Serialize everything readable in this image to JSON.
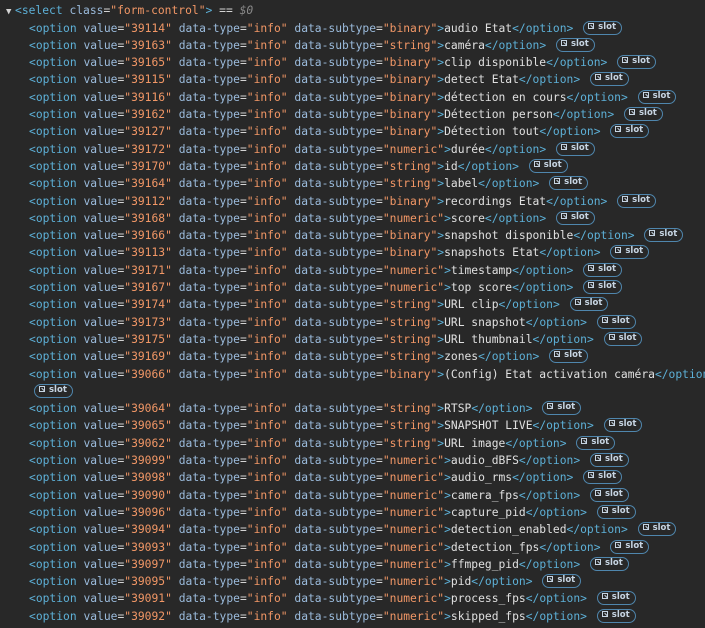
{
  "select": {
    "tag": "select",
    "attr_name": "class",
    "attr_value": "form-control",
    "eq_text": "==",
    "ref": "$0"
  },
  "option_tag": "option",
  "slot_label": "slot",
  "options": [
    {
      "value": "39114",
      "type": "info",
      "subtype": "binary",
      "text": "audio Etat"
    },
    {
      "value": "39163",
      "type": "info",
      "subtype": "string",
      "text": "caméra"
    },
    {
      "value": "39165",
      "type": "info",
      "subtype": "binary",
      "text": "clip disponible"
    },
    {
      "value": "39115",
      "type": "info",
      "subtype": "binary",
      "text": "detect Etat"
    },
    {
      "value": "39116",
      "type": "info",
      "subtype": "binary",
      "text": "détection en cours"
    },
    {
      "value": "39162",
      "type": "info",
      "subtype": "binary",
      "text": "Détection person"
    },
    {
      "value": "39127",
      "type": "info",
      "subtype": "binary",
      "text": "Détection tout"
    },
    {
      "value": "39172",
      "type": "info",
      "subtype": "numeric",
      "text": "durée"
    },
    {
      "value": "39170",
      "type": "info",
      "subtype": "string",
      "text": "id"
    },
    {
      "value": "39164",
      "type": "info",
      "subtype": "string",
      "text": "label"
    },
    {
      "value": "39112",
      "type": "info",
      "subtype": "binary",
      "text": "recordings Etat"
    },
    {
      "value": "39168",
      "type": "info",
      "subtype": "numeric",
      "text": "score"
    },
    {
      "value": "39166",
      "type": "info",
      "subtype": "binary",
      "text": "snapshot disponible"
    },
    {
      "value": "39113",
      "type": "info",
      "subtype": "binary",
      "text": "snapshots Etat"
    },
    {
      "value": "39171",
      "type": "info",
      "subtype": "numeric",
      "text": "timestamp"
    },
    {
      "value": "39167",
      "type": "info",
      "subtype": "numeric",
      "text": "top score"
    },
    {
      "value": "39174",
      "type": "info",
      "subtype": "string",
      "text": "URL clip"
    },
    {
      "value": "39173",
      "type": "info",
      "subtype": "string",
      "text": "URL snapshot"
    },
    {
      "value": "39175",
      "type": "info",
      "subtype": "string",
      "text": "URL thumbnail"
    },
    {
      "value": "39169",
      "type": "info",
      "subtype": "string",
      "text": "zones"
    },
    {
      "value": "39066",
      "type": "info",
      "subtype": "binary",
      "text": "(Config) Etat activation caméra",
      "wrap": true
    },
    {
      "value": "39064",
      "type": "info",
      "subtype": "string",
      "text": "RTSP"
    },
    {
      "value": "39065",
      "type": "info",
      "subtype": "string",
      "text": "SNAPSHOT LIVE"
    },
    {
      "value": "39062",
      "type": "info",
      "subtype": "string",
      "text": "URL image"
    },
    {
      "value": "39099",
      "type": "info",
      "subtype": "numeric",
      "text": "audio_dBFS"
    },
    {
      "value": "39098",
      "type": "info",
      "subtype": "numeric",
      "text": "audio_rms"
    },
    {
      "value": "39090",
      "type": "info",
      "subtype": "numeric",
      "text": "camera_fps"
    },
    {
      "value": "39096",
      "type": "info",
      "subtype": "numeric",
      "text": "capture_pid"
    },
    {
      "value": "39094",
      "type": "info",
      "subtype": "numeric",
      "text": "detection_enabled"
    },
    {
      "value": "39093",
      "type": "info",
      "subtype": "numeric",
      "text": "detection_fps"
    },
    {
      "value": "39097",
      "type": "info",
      "subtype": "numeric",
      "text": "ffmpeg_pid"
    },
    {
      "value": "39095",
      "type": "info",
      "subtype": "numeric",
      "text": "pid"
    },
    {
      "value": "39091",
      "type": "info",
      "subtype": "numeric",
      "text": "process_fps"
    },
    {
      "value": "39092",
      "type": "info",
      "subtype": "numeric",
      "text": "skipped_fps"
    }
  ],
  "colors": {
    "background": "#282828",
    "tag": "#5db0d7",
    "attr_name": "#9bbbdc",
    "attr_value": "#f29766",
    "text": "#e0e0e0",
    "badge_border": "#4f86ad"
  },
  "icons": {
    "expand": "triangle-down-icon",
    "slot": "reveal-slot-icon"
  }
}
